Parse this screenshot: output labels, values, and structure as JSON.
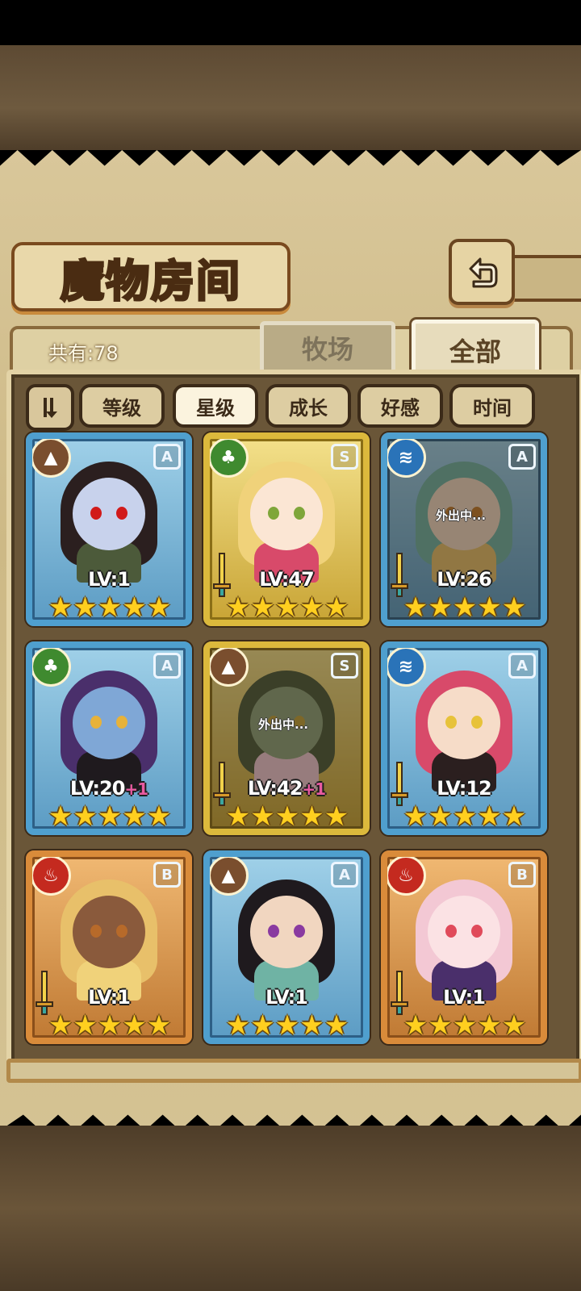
{
  "title": "魔物房间",
  "count_text": "共有:78",
  "tabs": {
    "farm": "牧场",
    "all": "全部"
  },
  "sort": {
    "toggle_icon": "sort-toggle-icon",
    "buttons": [
      "等级",
      "星级",
      "成长",
      "好感",
      "时间"
    ],
    "active": "星级"
  },
  "colors": {
    "blue_frame": "#4a9ac8",
    "gold_frame": "#d8b63a",
    "orange_frame": "#d2893a",
    "earth": "#7a4e2e",
    "wind": "#3f8a2f",
    "water": "#2a73b8",
    "fire": "#c42a1f"
  },
  "cards": [
    {
      "element": "earth",
      "element_icon": "earth-element-icon",
      "rank": "A",
      "level": "LV:1",
      "bonus": "",
      "away": "",
      "stars": 5,
      "frame": "blue",
      "has_sword": false
    },
    {
      "element": "wind",
      "element_icon": "leaf-element-icon",
      "rank": "S",
      "level": "LV:47",
      "bonus": "",
      "away": "",
      "stars": 5,
      "frame": "gold",
      "has_sword": true
    },
    {
      "element": "water",
      "element_icon": "water-element-icon",
      "rank": "A",
      "level": "LV:26",
      "bonus": "",
      "away": "外出中...",
      "stars": 5,
      "frame": "blue",
      "has_sword": true
    },
    {
      "element": "wind",
      "element_icon": "leaf-element-icon",
      "rank": "A",
      "level": "LV:20",
      "bonus": "+1",
      "away": "",
      "stars": 5,
      "frame": "blue",
      "has_sword": false
    },
    {
      "element": "earth",
      "element_icon": "earth-element-icon",
      "rank": "S",
      "level": "LV:42",
      "bonus": "+1",
      "away": "外出中...",
      "stars": 5,
      "frame": "gold",
      "has_sword": true
    },
    {
      "element": "water",
      "element_icon": "water-element-icon",
      "rank": "A",
      "level": "LV:12",
      "bonus": "",
      "away": "",
      "stars": 5,
      "frame": "blue",
      "has_sword": true
    },
    {
      "element": "fire",
      "element_icon": "fire-element-icon",
      "rank": "B",
      "level": "LV:1",
      "bonus": "",
      "away": "",
      "stars": 5,
      "frame": "orange",
      "has_sword": true
    },
    {
      "element": "earth",
      "element_icon": "earth-element-icon",
      "rank": "A",
      "level": "LV:1",
      "bonus": "",
      "away": "",
      "stars": 5,
      "frame": "blue",
      "has_sword": false
    },
    {
      "element": "fire",
      "element_icon": "fire-element-icon",
      "rank": "B",
      "level": "LV:1",
      "bonus": "",
      "away": "",
      "stars": 5,
      "frame": "orange",
      "has_sword": true
    }
  ]
}
